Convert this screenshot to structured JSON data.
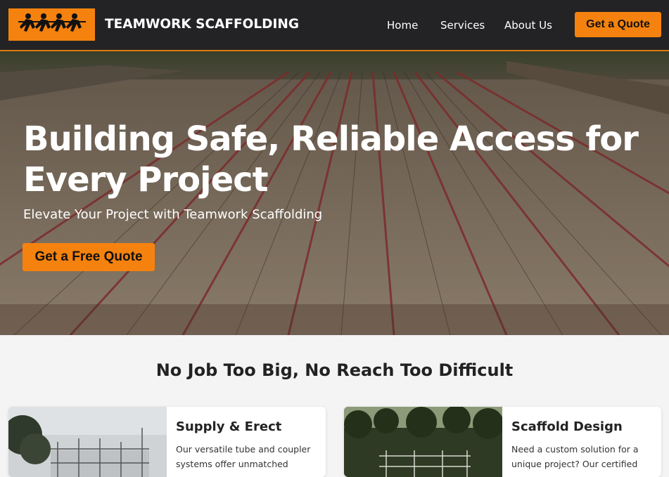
{
  "header": {
    "brand": "TEAMWORK SCAFFOLDING",
    "logo_icon": "tug-of-war-team-icon",
    "nav": [
      {
        "label": "Home"
      },
      {
        "label": "Services"
      },
      {
        "label": "About Us"
      }
    ],
    "cta_label": "Get a Quote"
  },
  "hero": {
    "title": "Building Safe, Reliable Access for Every Project",
    "subtitle": "Elevate Your Project with Teamwork Scaffolding",
    "cta_label": "Get a Free Quote"
  },
  "services": {
    "heading": "No Job Too Big, No Reach Too Difficult",
    "cards": [
      {
        "title": "Supply & Erect",
        "text": "Our versatile tube and coupler systems offer unmatched"
      },
      {
        "title": "Scaffold Design",
        "text": "Need a custom solution for a unique project? Our certified"
      }
    ]
  },
  "colors": {
    "accent": "#f5820e",
    "header_bg": "#232325",
    "page_bg": "#f4f4f4"
  }
}
